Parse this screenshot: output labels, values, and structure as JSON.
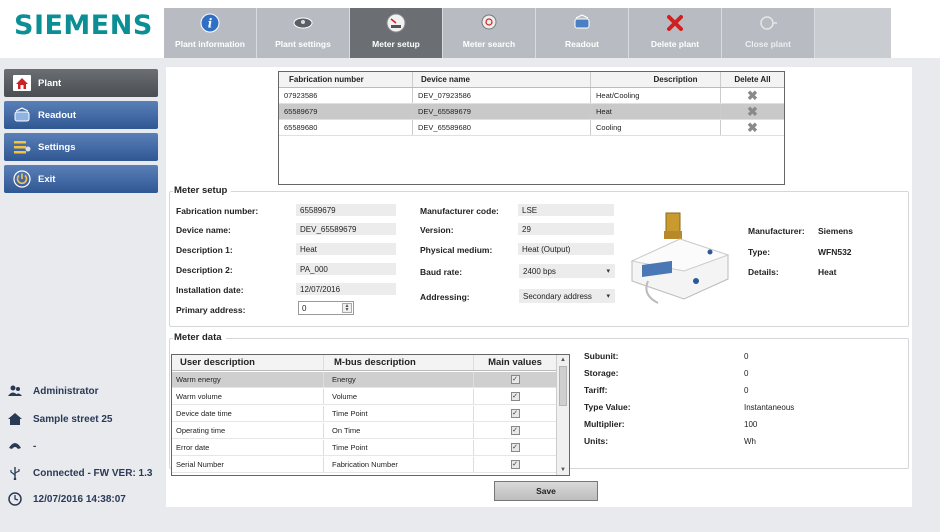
{
  "brand": {
    "logo_text": "SIEMENS",
    "color": "#0b8f94"
  },
  "toolbar": {
    "tabs": [
      {
        "label": "Plant information",
        "icon": "info-icon",
        "state": "normal"
      },
      {
        "label": "Plant settings",
        "icon": "settings-disc-icon",
        "state": "normal"
      },
      {
        "label": "Meter setup",
        "icon": "meter-gauge-icon",
        "state": "active"
      },
      {
        "label": "Meter search",
        "icon": "meter-search-icon",
        "state": "normal"
      },
      {
        "label": "Readout",
        "icon": "readout-icon",
        "state": "normal"
      },
      {
        "label": "Delete plant",
        "icon": "red-x-icon",
        "state": "normal"
      },
      {
        "label": "Close plant",
        "icon": "close-plug-icon",
        "state": "disabled"
      }
    ]
  },
  "sidebar": {
    "nav": [
      {
        "label": "Plant",
        "icon": "home-icon",
        "state": "active"
      },
      {
        "label": "Readout",
        "icon": "readout-icon",
        "state": "normal"
      },
      {
        "label": "Settings",
        "icon": "settings-list-icon",
        "state": "normal"
      },
      {
        "label": "Exit",
        "icon": "power-icon",
        "state": "normal"
      }
    ],
    "status": {
      "user": "Administrator",
      "address": "Sample street 25",
      "phone": "-",
      "connection": "Connected - FW VER: 1.3",
      "datetime": "12/07/2016 14:38:07"
    }
  },
  "device_table": {
    "headers": [
      "Fabrication number",
      "Device name",
      "Description",
      "Delete All"
    ],
    "rows": [
      {
        "fab": "07923586",
        "name": "DEV_07923586",
        "desc": "Heat/Cooling",
        "selected": false
      },
      {
        "fab": "65589679",
        "name": "DEV_65589679",
        "desc": "Heat",
        "selected": true
      },
      {
        "fab": "65589680",
        "name": "DEV_65589680",
        "desc": "Cooling",
        "selected": false
      }
    ]
  },
  "meter_setup": {
    "title": "Meter setup",
    "fabrication_number": {
      "label": "Fabrication number:",
      "value": "65589679"
    },
    "device_name": {
      "label": "Device name:",
      "value": "DEV_65589679"
    },
    "description1": {
      "label": "Description 1:",
      "value": "Heat"
    },
    "description2": {
      "label": "Description 2:",
      "value": "PA_000"
    },
    "installation_date": {
      "label": "Installation date:",
      "value": "12/07/2016"
    },
    "primary_address": {
      "label": "Primary address:",
      "value": "0"
    },
    "manufacturer_code": {
      "label": "Manufacturer code:",
      "value": "LSE"
    },
    "version": {
      "label": "Version:",
      "value": "29"
    },
    "physical_medium": {
      "label": "Physical medium:",
      "value": "Heat (Output)"
    },
    "baud_rate": {
      "label": "Baud rate:",
      "value": "2400 bps"
    },
    "addressing": {
      "label": "Addressing:",
      "value": "Secondary address"
    },
    "manufacturer": {
      "label": "Manufacturer:",
      "value": "Siemens"
    },
    "type": {
      "label": "Type:",
      "value": "WFN532"
    },
    "details": {
      "label": "Details:",
      "value": "Heat"
    }
  },
  "meter_data": {
    "title": "Meter data",
    "headers": [
      "User description",
      "M-bus description",
      "Main values"
    ],
    "rows": [
      {
        "user": "Warm energy",
        "mbus": "Energy",
        "checked": true,
        "selected": true
      },
      {
        "user": "Warm volume",
        "mbus": "Volume",
        "checked": true,
        "selected": false
      },
      {
        "user": "Device date time",
        "mbus": "Time Point",
        "checked": true,
        "selected": false
      },
      {
        "user": "Operating time",
        "mbus": "On Time",
        "checked": true,
        "selected": false
      },
      {
        "user": "Error date",
        "mbus": "Time Point",
        "checked": true,
        "selected": false
      },
      {
        "user": "Serial Number",
        "mbus": "Fabrication Number",
        "checked": true,
        "selected": false
      }
    ],
    "properties": [
      {
        "label": "Subunit:",
        "value": "0"
      },
      {
        "label": "Storage:",
        "value": "0"
      },
      {
        "label": "Tariff:",
        "value": "0"
      },
      {
        "label": "Type Value:",
        "value": "Instantaneous"
      },
      {
        "label": "Multiplier:",
        "value": "100"
      },
      {
        "label": "Units:",
        "value": "Wh"
      }
    ]
  },
  "save_button": {
    "label": "Save"
  }
}
